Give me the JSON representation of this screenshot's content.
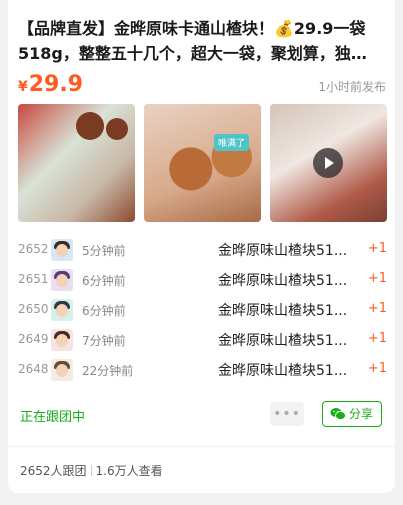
{
  "post": {
    "title_line1": "【品牌直发】金晔原味卡通山楂块！💰29.9一袋",
    "title_line2": "518g，整整五十几个，超大一袋，聚划算，独…",
    "price_currency": "¥",
    "price_value": "29.9",
    "posted_time": "1小时前发布",
    "video_badge": "唯满了"
  },
  "orders": [
    {
      "num": "2652",
      "time": "5分钟前",
      "product": "金晔原味山楂块51...",
      "qty": "+1"
    },
    {
      "num": "2651",
      "time": "6分钟前",
      "product": "金晔原味山楂块51...",
      "qty": "+1"
    },
    {
      "num": "2650",
      "time": "6分钟前",
      "product": "金晔原味山楂块51...",
      "qty": "+1"
    },
    {
      "num": "2649",
      "time": "7分钟前",
      "product": "金晔原味山楂块51...",
      "qty": "+1"
    },
    {
      "num": "2648",
      "time": "22分钟前",
      "product": "金晔原味山楂块51...",
      "qty": "+1"
    }
  ],
  "actions": {
    "status": "正在跟团中",
    "more": "•••",
    "share": "分享"
  },
  "stats": {
    "participants": "2652人跟团",
    "views": "1.6万人查看"
  },
  "colors": {
    "price": "#ff5a1f",
    "green": "#1aad19"
  }
}
